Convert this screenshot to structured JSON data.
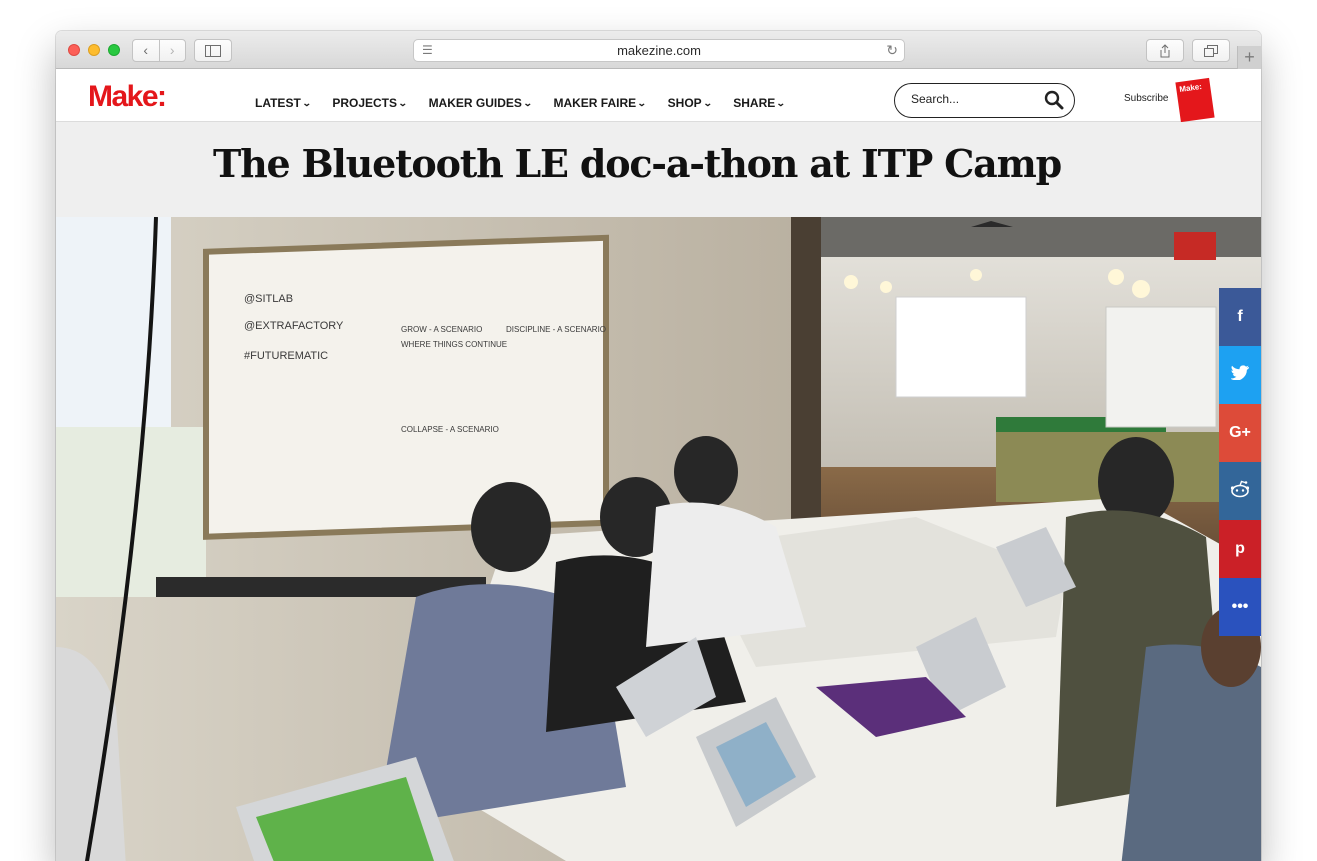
{
  "browser": {
    "url": "makezine.com",
    "back_icon": "‹",
    "forward_icon": "›",
    "newtab_icon": "+"
  },
  "site": {
    "logo": "Make:",
    "nav": [
      {
        "label": "LATEST"
      },
      {
        "label": "PROJECTS"
      },
      {
        "label": "MAKER GUIDES"
      },
      {
        "label": "MAKER FAIRE"
      },
      {
        "label": "SHOP"
      },
      {
        "label": "SHARE"
      }
    ],
    "search_placeholder": "Search...",
    "subscribe": "Subscribe",
    "magazine_label": "Make:"
  },
  "article": {
    "title": "The Bluetooth LE doc-a-thon at ITP Camp"
  },
  "social": [
    {
      "name": "facebook",
      "glyph": "f",
      "color": "#3b5998"
    },
    {
      "name": "twitter",
      "glyph": "t",
      "color": "#1da1f2"
    },
    {
      "name": "google-plus",
      "glyph": "G+",
      "color": "#dd4b39"
    },
    {
      "name": "reddit",
      "glyph": "r",
      "color": "#336699"
    },
    {
      "name": "pinterest",
      "glyph": "p",
      "color": "#cb2027"
    },
    {
      "name": "more",
      "glyph": "•••",
      "color": "#2a52be"
    }
  ]
}
